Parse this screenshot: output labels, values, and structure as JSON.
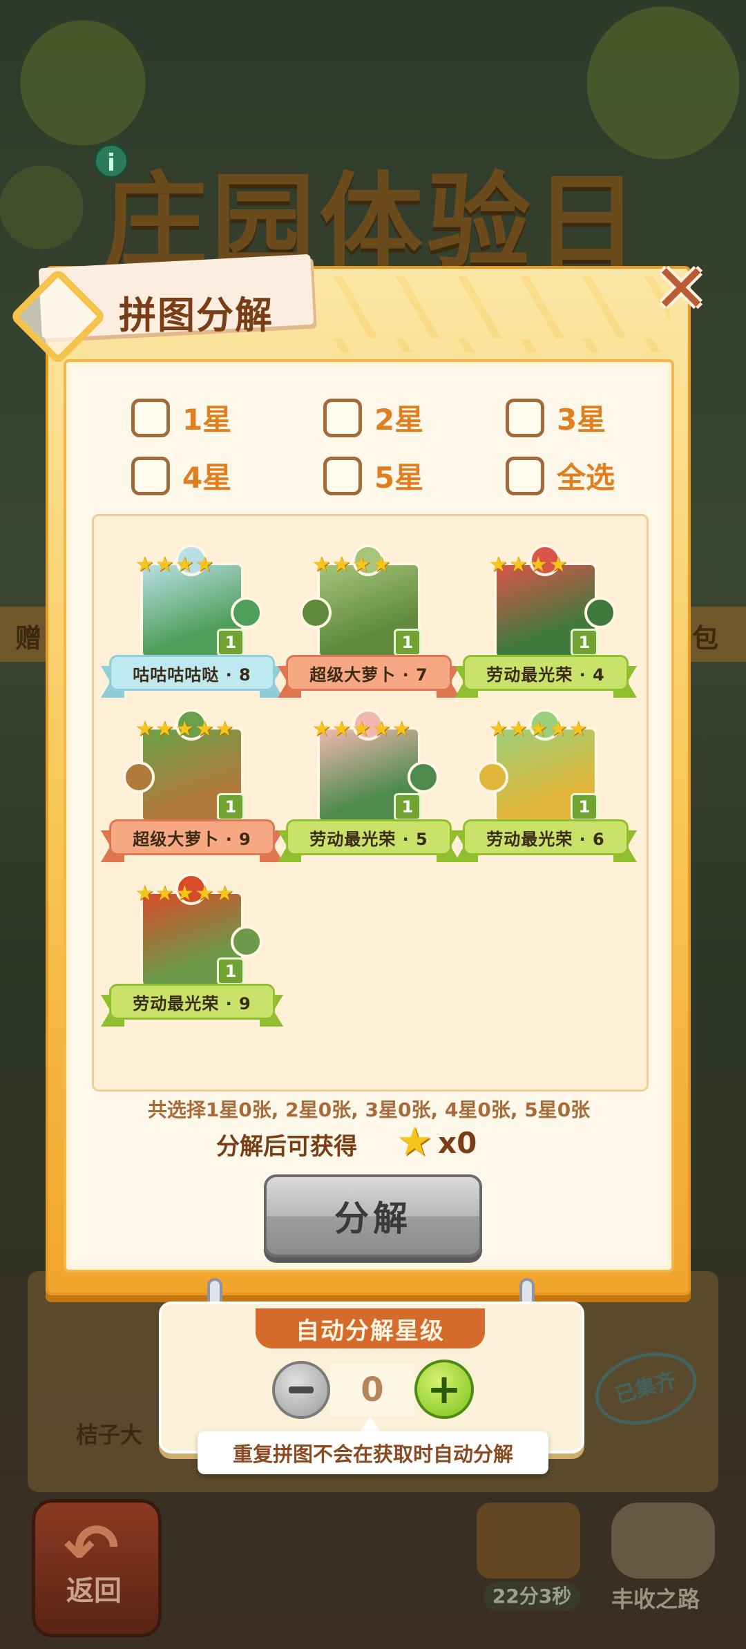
{
  "background": {
    "title": "庄园体验日",
    "strip_left": "赠",
    "strip_right": "包",
    "lower_item": "桔子大",
    "stamp": "已集齐",
    "back_label": "返回",
    "timer": "22分3秒",
    "road_label": "丰收之路"
  },
  "panel": {
    "title": "拼图分解",
    "close_symbol": "✕"
  },
  "filters": [
    {
      "label": "1星"
    },
    {
      "label": "2星"
    },
    {
      "label": "3星"
    },
    {
      "label": "4星"
    },
    {
      "label": "5星"
    },
    {
      "label": "全选"
    }
  ],
  "pieces": [
    {
      "name": "咕咕咕咕哒 · 8",
      "stars": 4,
      "count": "1",
      "ribbon": "#bfe9f0",
      "tail": "#8fcdd8",
      "art": [
        "#4f9f5a",
        "#b8dfe6"
      ]
    },
    {
      "name": "超级大萝卜 · 7",
      "stars": 4,
      "count": "1",
      "ribbon": "#f6a882",
      "tail": "#e07650",
      "art": [
        "#5f8a3c",
        "#a6c47a"
      ]
    },
    {
      "name": "劳动最光荣 · 4",
      "stars": 4,
      "count": "1",
      "ribbon": "#c9e36a",
      "tail": "#8fbf2f",
      "art": [
        "#3f7a3c",
        "#d9544a"
      ]
    },
    {
      "name": "超级大萝卜 · 9",
      "stars": 5,
      "count": "1",
      "ribbon": "#f6a882",
      "tail": "#e07650",
      "art": [
        "#b07a3a",
        "#6aa04a"
      ]
    },
    {
      "name": "劳动最光荣 · 5",
      "stars": 5,
      "count": "1",
      "ribbon": "#c9e36a",
      "tail": "#8fbf2f",
      "art": [
        "#4d8a4c",
        "#f0b8b0"
      ]
    },
    {
      "name": "劳动最光荣 · 6",
      "stars": 5,
      "count": "1",
      "ribbon": "#c9e36a",
      "tail": "#8fbf2f",
      "art": [
        "#e0b73a",
        "#9ccf7a"
      ]
    },
    {
      "name": "劳动最光荣 · 9",
      "stars": 5,
      "count": "1",
      "ribbon": "#c9e36a",
      "tail": "#8fbf2f",
      "art": [
        "#6d9a4a",
        "#d84a2a"
      ]
    }
  ],
  "summary": "共选择1星0张, 2星0张, 3星0张, 4星0张, 5星0张",
  "reward": {
    "label": "分解后可获得",
    "count": "x0"
  },
  "decompose_button": "分解",
  "auto": {
    "header": "自动分解星级",
    "value": "0",
    "tip": "重复拼图不会在获取时自动分解"
  },
  "colors": {
    "panel_orange": "#f8c653",
    "title_brown": "#7a3e17",
    "accent_orange": "#e07f1f",
    "plus_green": "#7cc11c"
  }
}
